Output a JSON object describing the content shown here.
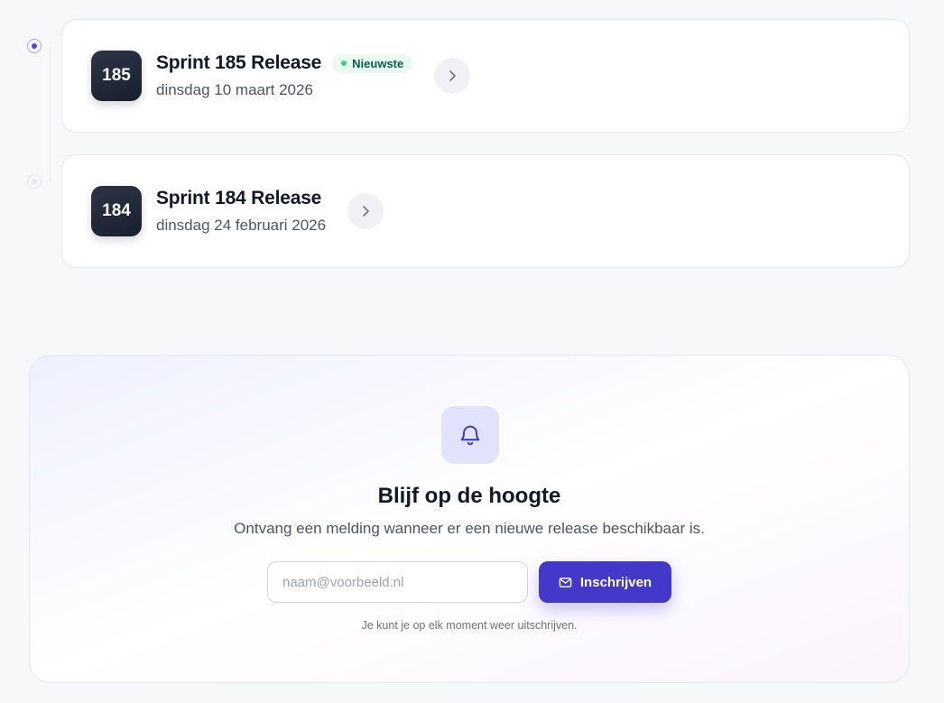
{
  "releases": [
    {
      "number": "185",
      "title": "Sprint 185 Release",
      "badge": "Nieuwste",
      "date": "dinsdag 10 maart 2026"
    },
    {
      "number": "184",
      "title": "Sprint 184 Release",
      "date": "dinsdag 24 februari 2026"
    }
  ],
  "subscribe": {
    "icon": "bell-icon",
    "title": "Blijf op de hoogte",
    "subtitle": "Ontvang een melding wanneer er een nieuwe release beschikbaar is.",
    "email_placeholder": "naam@voorbeeld.nl",
    "email_value": "",
    "button_label": "Inschrijven",
    "button_icon": "mail-icon",
    "note": "Je kunt je op elk moment weer uitschrijven."
  },
  "colors": {
    "accent": "#4338ca",
    "badge_dark": "#1f2433",
    "new_pill_bg": "#e9fbf1",
    "new_pill_text": "#065f46"
  }
}
